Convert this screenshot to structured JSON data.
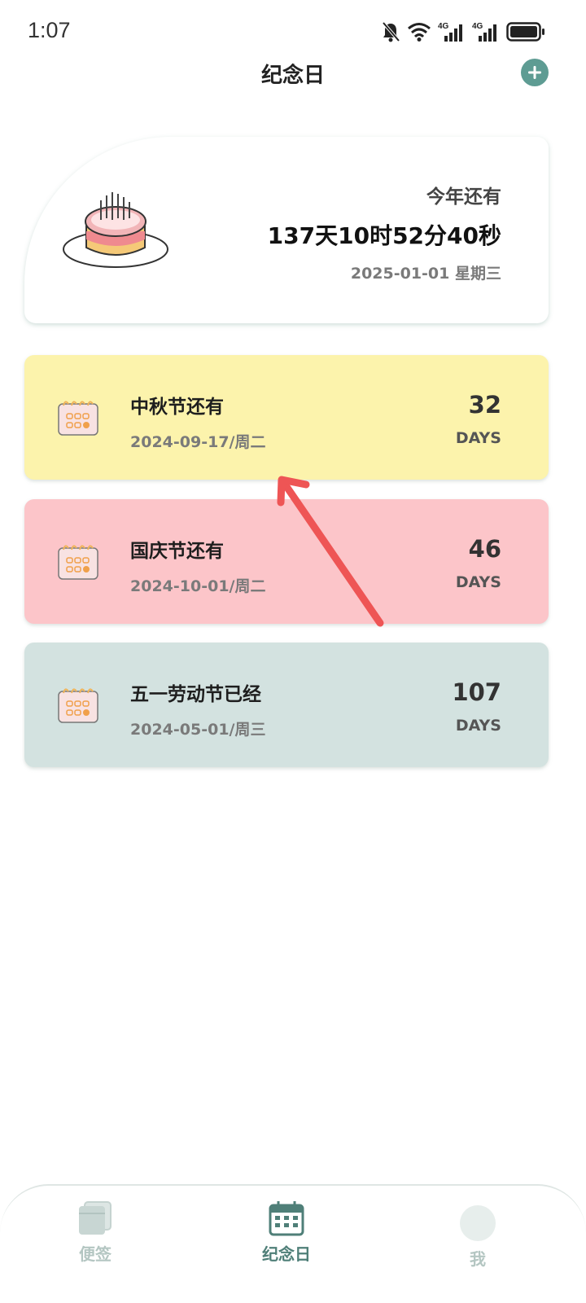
{
  "status_bar": {
    "time": "1:07",
    "icons": [
      "bell-muted-icon",
      "wifi-icon",
      "signal-4g-icon",
      "signal-4g-icon",
      "battery-icon"
    ]
  },
  "header": {
    "title": "纪念日",
    "add_icon": "plus-circle-icon"
  },
  "hero": {
    "label": "今年还有",
    "countdown": "137天10时52分40秒",
    "date": "2025-01-01 星期三",
    "illustration": "birthday-cake-icon"
  },
  "events": [
    {
      "title": "中秋节还有",
      "date": "2024-09-17/周二",
      "days": "32",
      "unit": "DAYS",
      "color": "#fcf3ac",
      "icon": "calendar-icon"
    },
    {
      "title": "国庆节还有",
      "date": "2024-10-01/周二",
      "days": "46",
      "unit": "DAYS",
      "color": "#fcc5c9",
      "icon": "calendar-icon"
    },
    {
      "title": "五一劳动节已经",
      "date": "2024-05-01/周三",
      "days": "107",
      "unit": "DAYS",
      "color": "#d3e2e0",
      "icon": "calendar-icon"
    }
  ],
  "bottom_nav": {
    "items": [
      {
        "label": "便签",
        "icon": "notes-icon",
        "active": false
      },
      {
        "label": "纪念日",
        "icon": "calendar-grid-icon",
        "active": true
      },
      {
        "label": "我",
        "icon": "avatar-icon",
        "active": false
      }
    ]
  },
  "colors": {
    "accent": "#5e9c93",
    "active_tab": "#4f7f78",
    "inactive_tab": "#b4c6c2"
  }
}
